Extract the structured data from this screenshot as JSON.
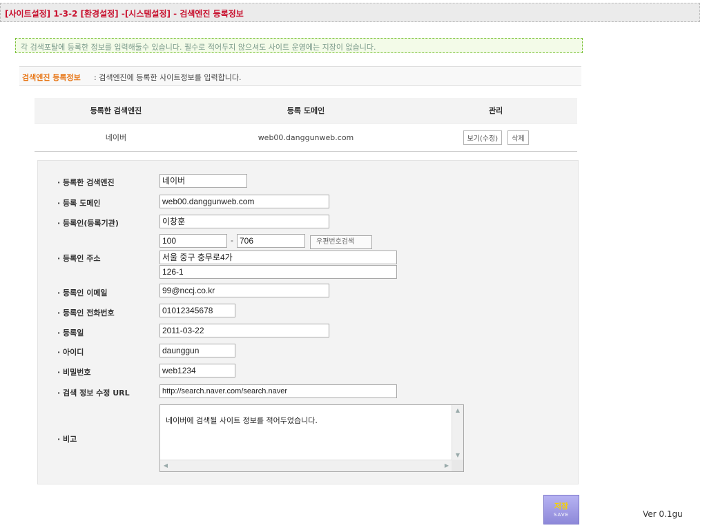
{
  "page_title": "[사이트설정] 1-3-2 [환경설정] -[시스템설정] - 검색엔진 등록정보",
  "notice": "각 검색포탈에 등록한 정보를 입력해둘수 있습니다. 필수로 적어두지 않으셔도 사이트 운영에는 지장이 없습니다.",
  "subhead": {
    "title": "검색엔진 등록정보",
    "desc": ": 검색엔진에 등록한 사이트정보를 입력합니다."
  },
  "list": {
    "headers": [
      "등록한 검색엔진",
      "등록 도메인",
      "관리"
    ],
    "rows": [
      {
        "engine": "네이버",
        "domain": "web00.danggunweb.com",
        "view_btn": "보기(수정)",
        "delete_btn": "삭제"
      }
    ]
  },
  "form": {
    "engine_label": "· 등록한 검색엔진",
    "engine_value": "네이버",
    "domain_label": "· 등록 도메인",
    "domain_value": "web00.danggunweb.com",
    "registrant_label": "· 등록인(등록기관)",
    "registrant_value": "이창훈",
    "zip1": "100",
    "zip_dash": "-",
    "zip2": "706",
    "zip_search_btn": "우편번호검색",
    "address_label": "· 등록인 주소",
    "address1": "서울 중구 충무로4가",
    "address2": "126-1",
    "email_label": "· 등록인 이메일",
    "email_value": "99@nccj.co.kr",
    "phone_label": "· 등록인 전화번호",
    "phone_value": "01012345678",
    "reg_date_label": "· 등록일",
    "reg_date_value": "2011-03-22",
    "id_label": "· 아이디",
    "id_value": "daunggun",
    "password_label": "· 비밀번호",
    "password_value": "web1234",
    "url_label": "· 검색 정보 수정 URL",
    "url_value": "http://search.naver.com/search.naver",
    "memo_label": "· 비고",
    "memo_value": "네이버에 검색될 사이트 정보를 적어두었습니다."
  },
  "save_button": {
    "label": "저장",
    "sub": "SAVE"
  },
  "version": "Ver 0.1gu",
  "colors": {
    "title": "#c8102e",
    "notice_border": "#7cc23a",
    "subhead_accent": "#e8791b",
    "save_bg": "#9c98e2"
  }
}
